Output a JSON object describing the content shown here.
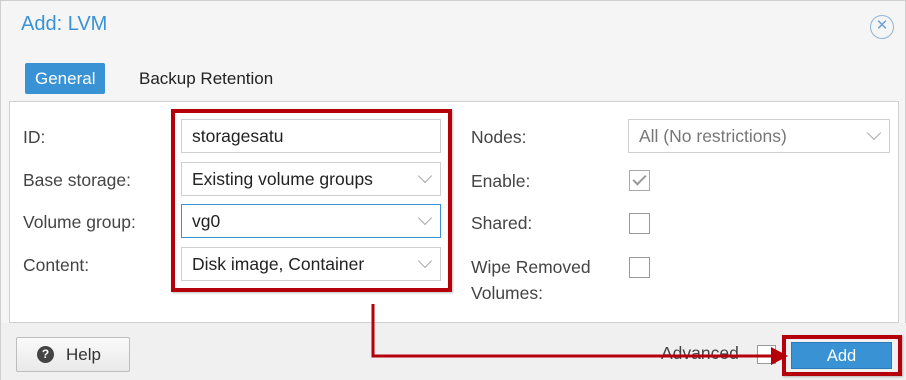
{
  "dialog": {
    "title": "Add: LVM",
    "close_icon": "close-icon"
  },
  "tabs": [
    {
      "label": "General",
      "active": true
    },
    {
      "label": "Backup Retention",
      "active": false
    }
  ],
  "left_form": {
    "id_label": "ID:",
    "id_value": "storagesatu",
    "base_storage_label": "Base storage:",
    "base_storage_value": "Existing volume groups",
    "volume_group_label": "Volume group:",
    "volume_group_value": "vg0",
    "content_label": "Content:",
    "content_value": "Disk image, Container"
  },
  "right_form": {
    "nodes_label": "Nodes:",
    "nodes_value": "All (No restrictions)",
    "enable_label": "Enable:",
    "enable_checked": true,
    "shared_label": "Shared:",
    "shared_checked": false,
    "wipe_label_line1": "Wipe Removed",
    "wipe_label_line2": "Volumes:",
    "wipe_checked": false
  },
  "footer": {
    "help_label": "Help",
    "advanced_label": "Advanced",
    "advanced_checked": false,
    "add_label": "Add"
  },
  "colors": {
    "accent": "#3892d4",
    "highlight": "#b3000b"
  }
}
